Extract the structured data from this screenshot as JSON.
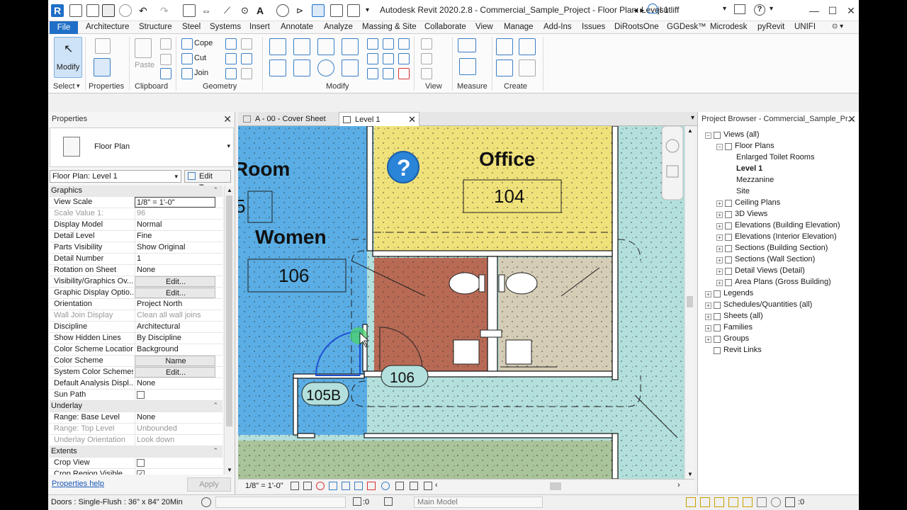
{
  "titlebar": {
    "title": "Autodesk Revit 2020.2.8 - Commercial_Sample_Project - Floor Plan: Level 1",
    "user": "jsutliff"
  },
  "menu": {
    "file": "File",
    "items": [
      "Architecture",
      "Structure",
      "Steel",
      "Systems",
      "Insert",
      "Annotate",
      "Analyze",
      "Massing & Site",
      "Collaborate",
      "View",
      "Manage",
      "Add-Ins",
      "Issues",
      "DiRootsOne",
      "GGDesk™",
      "Microdesk",
      "pyRevit",
      "UNIFI"
    ]
  },
  "ribbon": {
    "modify": "Modify",
    "paste": "Paste",
    "cope": "Cope",
    "cut": "Cut",
    "join": "Join",
    "panels": {
      "select": "Select",
      "properties": "Properties",
      "clipboard": "Clipboard",
      "geometry": "Geometry",
      "modify": "Modify",
      "view": "View",
      "measure": "Measure",
      "create": "Create"
    }
  },
  "properties": {
    "header": "Properties",
    "type_name": "Floor Plan",
    "instance": "Floor Plan: Level 1",
    "edit_type": "Edit Type",
    "help": "Properties help",
    "apply": "Apply",
    "rows": [
      {
        "group": "Graphics"
      },
      {
        "name": "View Scale",
        "value": "1/8\" = 1'-0\"",
        "edit": true
      },
      {
        "name": "Scale Value   1:",
        "value": "96",
        "disabled": true
      },
      {
        "name": "Display Model",
        "value": "Normal"
      },
      {
        "name": "Detail Level",
        "value": "Fine"
      },
      {
        "name": "Parts Visibility",
        "value": "Show Original"
      },
      {
        "name": "Detail Number",
        "value": "1"
      },
      {
        "name": "Rotation on Sheet",
        "value": "None"
      },
      {
        "name": "Visibility/Graphics Ov...",
        "value": "Edit...",
        "button": true
      },
      {
        "name": "Graphic Display Optio...",
        "value": "Edit...",
        "button": true
      },
      {
        "name": "Orientation",
        "value": "Project North"
      },
      {
        "name": "Wall Join Display",
        "value": "Clean all wall joins",
        "disabled": true
      },
      {
        "name": "Discipline",
        "value": "Architectural"
      },
      {
        "name": "Show Hidden Lines",
        "value": "By Discipline"
      },
      {
        "name": "Color Scheme Location",
        "value": "Background"
      },
      {
        "name": "Color Scheme",
        "value": "Name",
        "button": true
      },
      {
        "name": "System Color Schemes",
        "value": "Edit...",
        "button": true
      },
      {
        "name": "Default Analysis Displ...",
        "value": "None"
      },
      {
        "name": "Sun Path",
        "value": "",
        "checkbox": false
      },
      {
        "group": "Underlay"
      },
      {
        "name": "Range: Base Level",
        "value": "None"
      },
      {
        "name": "Range: Top Level",
        "value": "Unbounded",
        "disabled": true
      },
      {
        "name": "Underlay Orientation",
        "value": "Look down",
        "disabled": true
      },
      {
        "group": "Extents"
      },
      {
        "name": "Crop View",
        "value": "",
        "checkbox": false
      },
      {
        "name": "Crop Region Visible",
        "value": "",
        "checkbox": true
      }
    ]
  },
  "tabs": [
    {
      "label": "A - 00 - Cover Sheet",
      "active": false
    },
    {
      "label": "Level 1",
      "active": true
    }
  ],
  "plan": {
    "rooms": [
      {
        "name": "Room",
        "number": "5"
      },
      {
        "name": "Office",
        "number": "104"
      },
      {
        "name": "Women",
        "number": "106"
      }
    ],
    "tag_106": "106",
    "tag_105b": "105B",
    "colors": {
      "blue_room": "#5aaee5",
      "office": "#f0e27a",
      "toilet1": "#b86a55",
      "toilet2": "#d6cdb7",
      "corridor": "#b3e0dc",
      "south": "#a9c39a"
    }
  },
  "view_control": {
    "scale": "1/8\" = 1'-0\""
  },
  "browser": {
    "header": "Project Browser - Commercial_Sample_Pr...",
    "nodes": [
      {
        "label": "Views (all)",
        "level": 0,
        "exp": "−"
      },
      {
        "label": "Floor Plans",
        "level": 1,
        "exp": "−"
      },
      {
        "label": "Enlarged Toilet Rooms",
        "level": 2
      },
      {
        "label": "Level 1",
        "level": 2,
        "bold": true
      },
      {
        "label": "Mezzanine",
        "level": 2
      },
      {
        "label": "Site",
        "level": 2
      },
      {
        "label": "Ceiling Plans",
        "level": 1,
        "exp": "+"
      },
      {
        "label": "3D Views",
        "level": 1,
        "exp": "+"
      },
      {
        "label": "Elevations (Building Elevation)",
        "level": 1,
        "exp": "+"
      },
      {
        "label": "Elevations (Interior Elevation)",
        "level": 1,
        "exp": "+"
      },
      {
        "label": "Sections (Building Section)",
        "level": 1,
        "exp": "+"
      },
      {
        "label": "Sections (Wall Section)",
        "level": 1,
        "exp": "+"
      },
      {
        "label": "Detail Views (Detail)",
        "level": 1,
        "exp": "+"
      },
      {
        "label": "Area Plans (Gross Building)",
        "level": 1,
        "exp": "+"
      },
      {
        "label": "Legends",
        "level": 0,
        "exp": "+"
      },
      {
        "label": "Schedules/Quantities (all)",
        "level": 0,
        "exp": "+"
      },
      {
        "label": "Sheets (all)",
        "level": 0,
        "exp": "+"
      },
      {
        "label": "Families",
        "level": 0,
        "exp": "+"
      },
      {
        "label": "Groups",
        "level": 0,
        "exp": "+"
      },
      {
        "label": "Revit Links",
        "level": 0
      }
    ]
  },
  "status": {
    "text": "Doors : Single-Flush : 36\" x 84\" 20Min",
    "coord": ":0",
    "model": "Main Model",
    "filter": ":0"
  }
}
